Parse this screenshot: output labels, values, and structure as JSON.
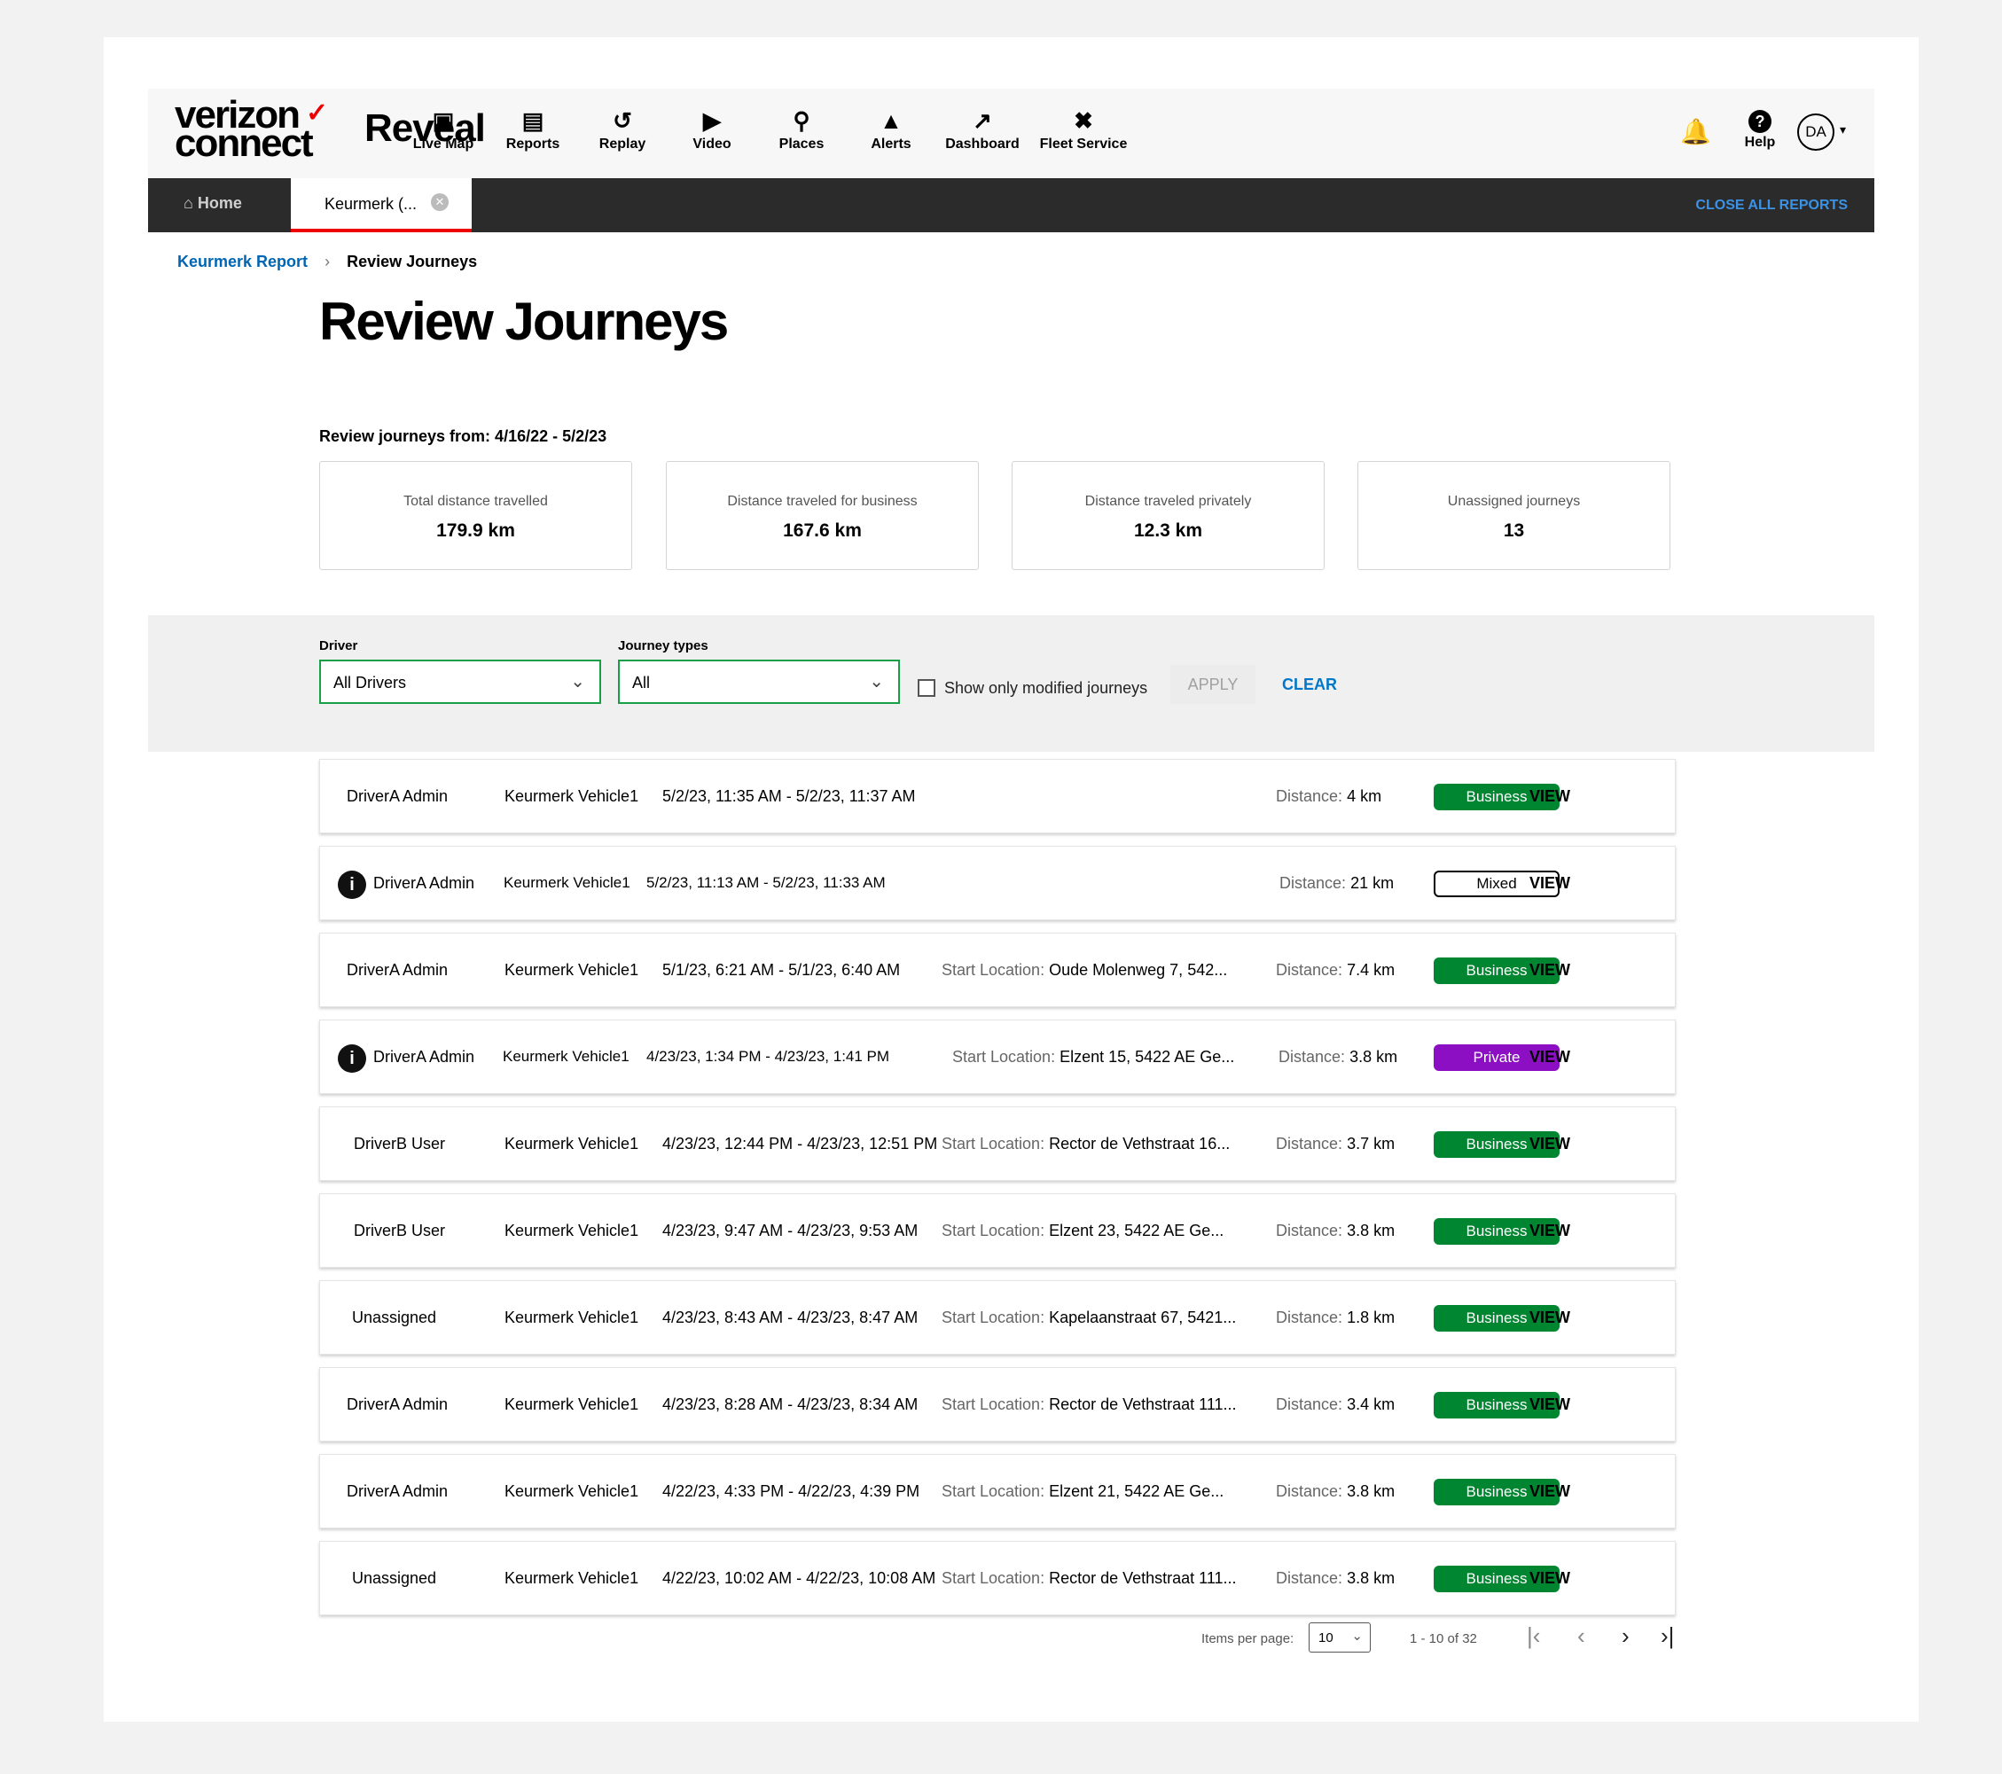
{
  "brand": {
    "logo_line1": "verizon",
    "logo_line2": "connect",
    "product": "Reveal"
  },
  "nav": [
    {
      "label": "Live Map",
      "icon": "live-map-icon"
    },
    {
      "label": "Reports",
      "icon": "reports-icon"
    },
    {
      "label": "Replay",
      "icon": "replay-icon"
    },
    {
      "label": "Video",
      "icon": "video-icon"
    },
    {
      "label": "Places",
      "icon": "places-icon"
    },
    {
      "label": "Alerts",
      "icon": "alerts-icon"
    },
    {
      "label": "Dashboard",
      "icon": "dashboard-icon"
    },
    {
      "label": "Fleet Service",
      "icon": "fleet-service-icon"
    }
  ],
  "header_right": {
    "help": "Help",
    "avatar": "DA"
  },
  "tabs": {
    "home": "Home",
    "report": "Keurmerk (...",
    "close_all": "CLOSE ALL REPORTS"
  },
  "breadcrumb": {
    "parent": "Keurmerk Report",
    "current": "Review Journeys"
  },
  "page": {
    "title": "Review Journeys",
    "range_label": "Review journeys from: 4/16/22 - 5/2/23"
  },
  "summary": [
    {
      "label": "Total distance travelled",
      "value": "179.9 km"
    },
    {
      "label": "Distance traveled for business",
      "value": "167.6 km"
    },
    {
      "label": "Distance traveled privately",
      "value": "12.3 km"
    },
    {
      "label": "Unassigned journeys",
      "value": "13"
    }
  ],
  "filters": {
    "driver_label": "Driver",
    "driver_value": "All Drivers",
    "type_label": "Journey types",
    "type_value": "All",
    "modified_label": "Show only modified journeys",
    "apply": "APPLY",
    "clear": "CLEAR"
  },
  "labels": {
    "start": "Start Location:",
    "distance": "Distance:",
    "view": "VIEW"
  },
  "journeys": [
    {
      "driver": "DriverA Admin",
      "vehicle": "Keurmerk Vehicle1",
      "time": "5/2/23, 11:35 AM - 5/2/23, 11:37 AM",
      "start": "",
      "distance": "4 km",
      "type": "Business"
    },
    {
      "driver": "DriverA Admin",
      "vehicle": "Keurmerk Vehicle1",
      "time": "5/2/23, 11:13 AM - 5/2/23, 11:33 AM",
      "start": "",
      "distance": "21 km",
      "type": "Mixed"
    },
    {
      "driver": "DriverA Admin",
      "vehicle": "Keurmerk Vehicle1",
      "time": "5/1/23, 6:21 AM - 5/1/23, 6:40 AM",
      "start": "Oude Molenweg 7, 542...",
      "distance": "7.4 km",
      "type": "Business"
    },
    {
      "driver": "DriverA Admin",
      "vehicle": "Keurmerk Vehicle1",
      "time": "4/23/23, 1:34 PM - 4/23/23, 1:41 PM",
      "start": "Elzent 15, 5422 AE Ge...",
      "distance": "3.8 km",
      "type": "Private"
    },
    {
      "driver": "DriverB User",
      "vehicle": "Keurmerk Vehicle1",
      "time": "4/23/23, 12:44 PM - 4/23/23, 12:51 PM",
      "start": "Rector de Vethstraat 16...",
      "distance": "3.7 km",
      "type": "Business"
    },
    {
      "driver": "DriverB User",
      "vehicle": "Keurmerk Vehicle1",
      "time": "4/23/23, 9:47 AM - 4/23/23, 9:53 AM",
      "start": "Elzent 23, 5422 AE Ge...",
      "distance": "3.8 km",
      "type": "Business"
    },
    {
      "driver": "Unassigned",
      "vehicle": "Keurmerk Vehicle1",
      "time": "4/23/23, 8:43 AM - 4/23/23, 8:47 AM",
      "start": "Kapelaanstraat 67, 5421...",
      "distance": "1.8 km",
      "type": "Business"
    },
    {
      "driver": "DriverA Admin",
      "vehicle": "Keurmerk Vehicle1",
      "time": "4/23/23, 8:28 AM - 4/23/23, 8:34 AM",
      "start": "Rector de Vethstraat 111...",
      "distance": "3.4 km",
      "type": "Business"
    },
    {
      "driver": "DriverA Admin",
      "vehicle": "Keurmerk Vehicle1",
      "time": "4/22/23, 4:33 PM - 4/22/23, 4:39 PM",
      "start": "Elzent 21, 5422 AE Ge...",
      "distance": "3.8 km",
      "type": "Business"
    },
    {
      "driver": "Unassigned",
      "vehicle": "Keurmerk Vehicle1",
      "time": "4/22/23, 10:02 AM - 4/22/23, 10:08 AM",
      "start": "Rector de Vethstraat 111...",
      "distance": "3.8 km",
      "type": "Business"
    }
  ],
  "pagination": {
    "items_label": "Items per page:",
    "per_page": "10",
    "range": "1 - 10 of 32"
  },
  "colors": {
    "business": "#008530",
    "private": "#8c0fc4",
    "accent": "#e00000",
    "link": "#0066b3",
    "select_border": "#17a046"
  }
}
